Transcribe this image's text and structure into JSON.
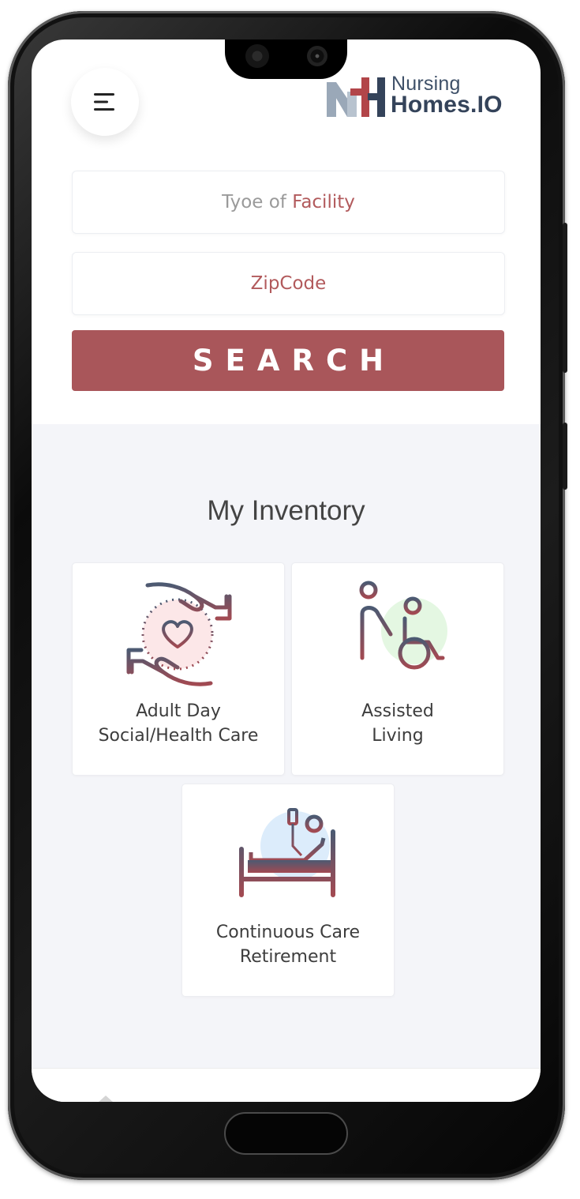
{
  "brand": {
    "line1": "Nursing",
    "line2": "Homes.IO",
    "colors": {
      "navy": "#34435a",
      "accent": "#b24549",
      "steel": "#9aa8b8"
    }
  },
  "header": {
    "menu_icon": "hamburger-menu-icon"
  },
  "search": {
    "facility_placeholder_prefix": "Tyoe of ",
    "facility_placeholder_word": "Facility",
    "zip_placeholder": "ZipCode",
    "button_label": "SEARCH",
    "button_color": "#a9565a"
  },
  "inventory": {
    "title": "My Inventory",
    "background": "#f4f5f9",
    "cards": [
      {
        "icon": "caring-hands-heart-icon",
        "line1": "Adult Day",
        "line2": "Social/Health Care"
      },
      {
        "icon": "wheelchair-assist-icon",
        "line1": "Assisted",
        "line2": "Living"
      },
      {
        "icon": "hospital-bed-icon",
        "line1": "Continuous Care",
        "line2": "Retirement"
      }
    ]
  }
}
